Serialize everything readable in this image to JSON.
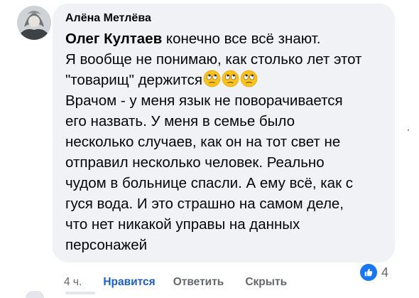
{
  "comment": {
    "author": "Алёна Метлёва",
    "mention": "Олег Култаев",
    "lines": [
      " конечно все всё знают.",
      "Я вообще не понимаю, как столько лет этот",
      "\"товарищ\" держится",
      "Врачом - у меня язык не поворачивается",
      "его назвать. У меня в семье было",
      "несколько случаев, как он на тот свет не",
      "отправил несколько человек. Реально",
      "чудом в больнице спасли. А ему всё, как с",
      "гуся вода. И это страшно на самом деле,",
      "что нет никакой управы на данных",
      "персонажей"
    ],
    "emoji_icons": [
      "rolling-eyes-emoji",
      "rolling-eyes-emoji",
      "rolling-eyes-emoji"
    ],
    "time": "4 ч.",
    "actions": {
      "like": "Нравится",
      "reply": "Ответить",
      "hide": "Скрыть"
    },
    "reactions": {
      "icon": "like-icon",
      "count": "4"
    }
  },
  "colors": {
    "bubble": "#f0f2f5",
    "text": "#050505",
    "secondary": "#65676b",
    "like_active": "#1d5ec2",
    "reaction_blue": "#1877f2",
    "emoji_yellow": "#fcc21b"
  }
}
